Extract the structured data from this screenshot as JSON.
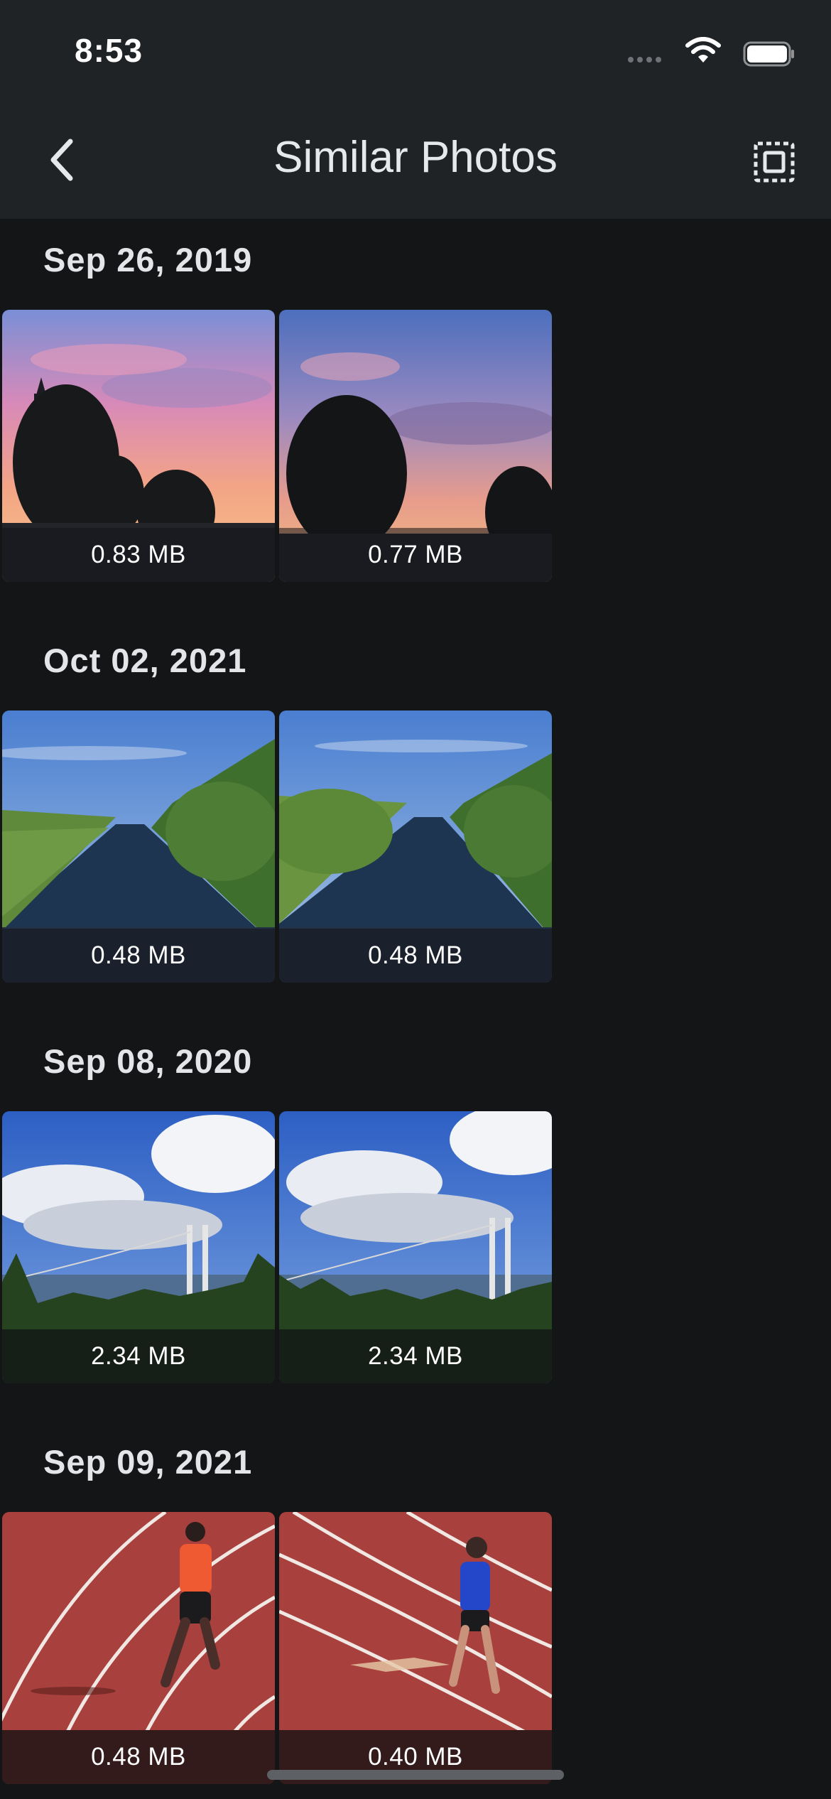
{
  "status_bar": {
    "time": "8:53"
  },
  "nav": {
    "title": "Similar Photos"
  },
  "groups": [
    {
      "date": "Sep 26, 2019",
      "photos": [
        {
          "size": "0.83 MB"
        },
        {
          "size": "0.77 MB"
        }
      ]
    },
    {
      "date": "Oct 02, 2021",
      "photos": [
        {
          "size": "0.48 MB"
        },
        {
          "size": "0.48 MB"
        }
      ]
    },
    {
      "date": "Sep 08, 2020",
      "photos": [
        {
          "size": "2.34 MB"
        },
        {
          "size": "2.34 MB"
        }
      ]
    },
    {
      "date": "Sep 09, 2021",
      "photos": [
        {
          "size": "0.48 MB"
        },
        {
          "size": "0.40 MB"
        }
      ]
    }
  ],
  "colors": {
    "background": "#141516",
    "header": "#202326",
    "text": "#e3e5e8"
  }
}
